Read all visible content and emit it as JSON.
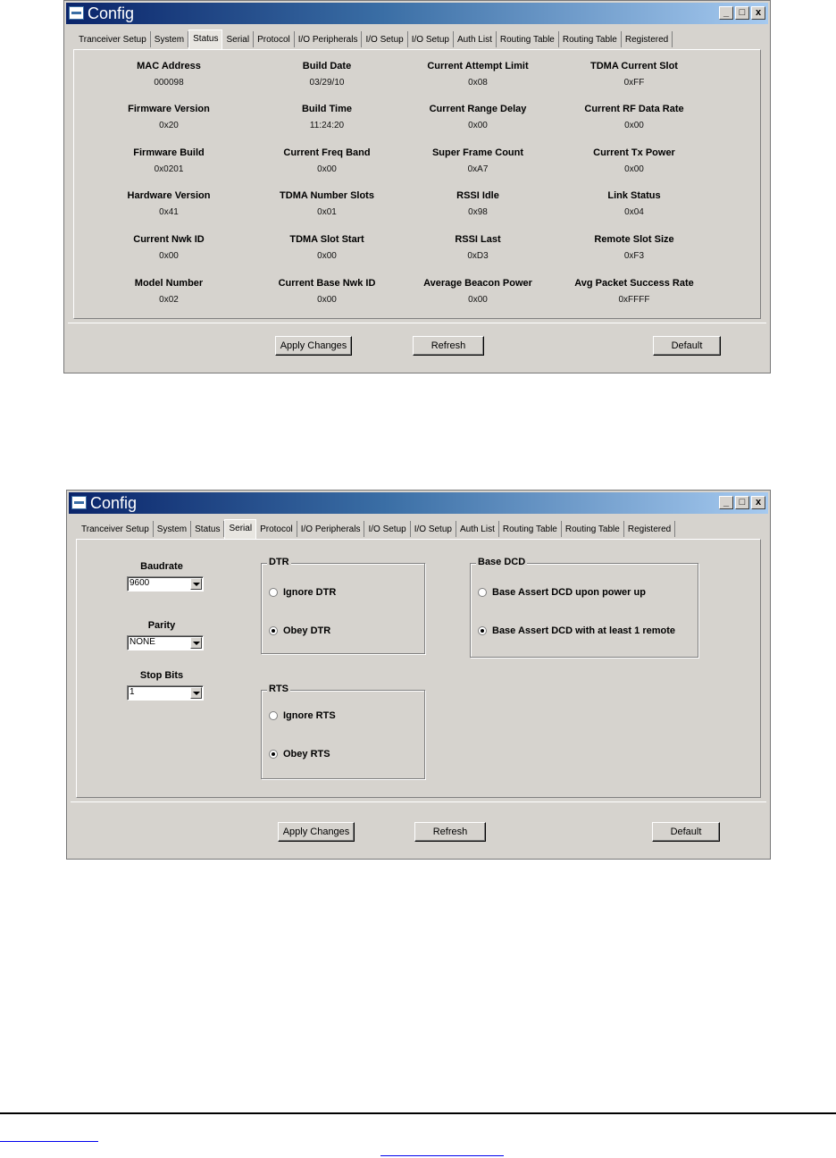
{
  "window_title": "Config",
  "title_buttons": {
    "minimize": "_",
    "maximize": "□",
    "close": "x"
  },
  "tabs": [
    "Tranceiver Setup",
    "System",
    "Status",
    "Serial",
    "Protocol",
    "I/O Peripherals",
    "I/O Setup",
    "I/O Setup",
    "Auth List",
    "Routing Table",
    "Routing Table",
    "Registered"
  ],
  "buttons": {
    "apply": "Apply Changes",
    "refresh": "Refresh",
    "default": "Default"
  },
  "status_window": {
    "active_tab": "Status",
    "columns": [
      [
        {
          "label": "MAC Address",
          "value": "000098"
        },
        {
          "label": "Firmware Version",
          "value": "0x20"
        },
        {
          "label": "Firmware Build",
          "value": "0x0201"
        },
        {
          "label": "Hardware Version",
          "value": "0x41"
        },
        {
          "label": "Current Nwk ID",
          "value": "0x00"
        },
        {
          "label": "Model Number",
          "value": "0x02"
        }
      ],
      [
        {
          "label": "Build Date",
          "value": "03/29/10"
        },
        {
          "label": "Build Time",
          "value": "11:24:20"
        },
        {
          "label": "Current Freq Band",
          "value": "0x00"
        },
        {
          "label": "TDMA Number Slots",
          "value": "0x01"
        },
        {
          "label": "TDMA Slot Start",
          "value": "0x00"
        },
        {
          "label": "Current Base Nwk ID",
          "value": "0x00"
        }
      ],
      [
        {
          "label": "Current Attempt Limit",
          "value": "0x08"
        },
        {
          "label": "Current Range Delay",
          "value": "0x00"
        },
        {
          "label": "Super Frame Count",
          "value": "0xA7"
        },
        {
          "label": "RSSI Idle",
          "value": "0x98"
        },
        {
          "label": "RSSI Last",
          "value": "0xD3"
        },
        {
          "label": "Average Beacon Power",
          "value": "0x00"
        }
      ],
      [
        {
          "label": "TDMA Current Slot",
          "value": "0xFF"
        },
        {
          "label": "Current RF Data Rate",
          "value": "0x00"
        },
        {
          "label": "Current Tx Power",
          "value": "0x00"
        },
        {
          "label": "Link Status",
          "value": "0x04"
        },
        {
          "label": "Remote Slot Size",
          "value": "0xF3"
        },
        {
          "label": "Avg Packet Success Rate",
          "value": "0xFFFF"
        }
      ]
    ]
  },
  "serial_window": {
    "active_tab": "Serial",
    "baudrate": {
      "label": "Baudrate",
      "value": "9600"
    },
    "parity": {
      "label": "Parity",
      "value": "NONE"
    },
    "stop_bits": {
      "label": "Stop Bits",
      "value": "1"
    },
    "dtr": {
      "legend": "DTR",
      "options": [
        "Ignore DTR",
        "Obey DTR"
      ],
      "selected": "Obey DTR"
    },
    "rts": {
      "legend": "RTS",
      "options": [
        "Ignore RTS",
        "Obey RTS"
      ],
      "selected": "Obey RTS"
    },
    "base_dcd": {
      "legend": "Base DCD",
      "options": [
        "Base Assert DCD upon power up",
        "Base Assert DCD with at least 1 remote"
      ],
      "selected": "Base Assert DCD with at least 1 remote"
    }
  }
}
